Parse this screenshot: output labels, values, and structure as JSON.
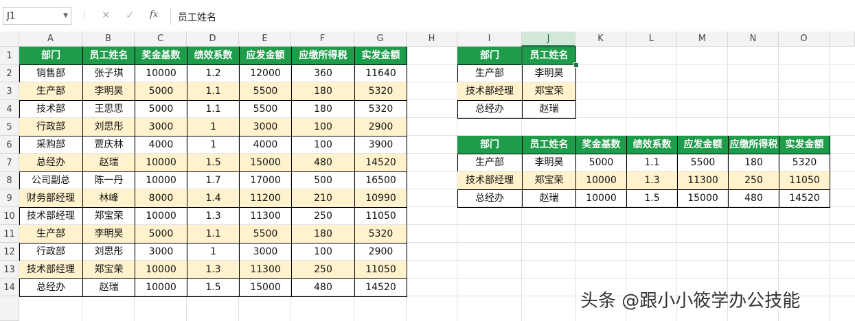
{
  "formula_bar": {
    "cell_ref": "J1",
    "fx_label": "fx",
    "cancel_glyph": "✕",
    "confirm_glyph": "✓",
    "content": "员工姓名"
  },
  "columns": [
    "A",
    "B",
    "C",
    "D",
    "E",
    "F",
    "G",
    "H",
    "I",
    "J",
    "K",
    "L",
    "M",
    "N",
    "O"
  ],
  "rows": [
    "1",
    "2",
    "3",
    "4",
    "5",
    "6",
    "7",
    "8",
    "9",
    "10",
    "11",
    "12",
    "13",
    "14"
  ],
  "selected_column": "J",
  "main_table": {
    "headers": [
      "部门",
      "员工姓名",
      "奖金基数",
      "绩效系数",
      "应发金额",
      "应缴所得税",
      "实发金额"
    ],
    "rows": [
      [
        "销售部",
        "张子琪",
        "10000",
        "1.2",
        "12000",
        "360",
        "11640"
      ],
      [
        "生产部",
        "李明昊",
        "5000",
        "1.1",
        "5500",
        "180",
        "5320"
      ],
      [
        "技术部",
        "王思思",
        "5000",
        "1.1",
        "5500",
        "180",
        "5320"
      ],
      [
        "行政部",
        "刘思彤",
        "3000",
        "1",
        "3000",
        "100",
        "2900"
      ],
      [
        "采购部",
        "贾庆林",
        "4000",
        "1",
        "4000",
        "100",
        "3900"
      ],
      [
        "总经办",
        "赵瑞",
        "10000",
        "1.5",
        "15000",
        "480",
        "14520"
      ],
      [
        "公司副总",
        "陈一丹",
        "10000",
        "1.7",
        "17000",
        "500",
        "16500"
      ],
      [
        "财务部经理",
        "林峰",
        "8000",
        "1.4",
        "11200",
        "210",
        "10990"
      ],
      [
        "技术部经理",
        "郑宝荣",
        "10000",
        "1.3",
        "11300",
        "250",
        "11050"
      ],
      [
        "生产部",
        "李明昊",
        "5000",
        "1.1",
        "5500",
        "180",
        "5320"
      ],
      [
        "行政部",
        "刘思彤",
        "3000",
        "1",
        "3000",
        "100",
        "2900"
      ],
      [
        "技术部经理",
        "郑宝荣",
        "10000",
        "1.3",
        "11300",
        "250",
        "11050"
      ],
      [
        "总经办",
        "赵瑞",
        "10000",
        "1.5",
        "15000",
        "480",
        "14520"
      ]
    ]
  },
  "lookup_table": {
    "headers": [
      "部门",
      "员工姓名"
    ],
    "rows": [
      [
        "生产部",
        "李明昊"
      ],
      [
        "技术部经理",
        "郑宝荣"
      ],
      [
        "总经办",
        "赵瑞"
      ]
    ]
  },
  "result_table": {
    "headers": [
      "部门",
      "员工姓名",
      "奖金基数",
      "绩效系数",
      "应发金额",
      "应缴所得税",
      "实发金额"
    ],
    "rows": [
      [
        "生产部",
        "李明昊",
        "5000",
        "1.1",
        "5500",
        "180",
        "5320"
      ],
      [
        "技术部经理",
        "郑宝荣",
        "10000",
        "1.3",
        "11300",
        "250",
        "11050"
      ],
      [
        "总经办",
        "赵瑞",
        "10000",
        "1.5",
        "15000",
        "480",
        "14520"
      ]
    ]
  },
  "watermark": "头条 @跟小小筱学办公技能",
  "colors": {
    "header_green": "#1e9c4a",
    "alt_row_yellow": "#fff2cc",
    "selection_green": "#217346"
  }
}
